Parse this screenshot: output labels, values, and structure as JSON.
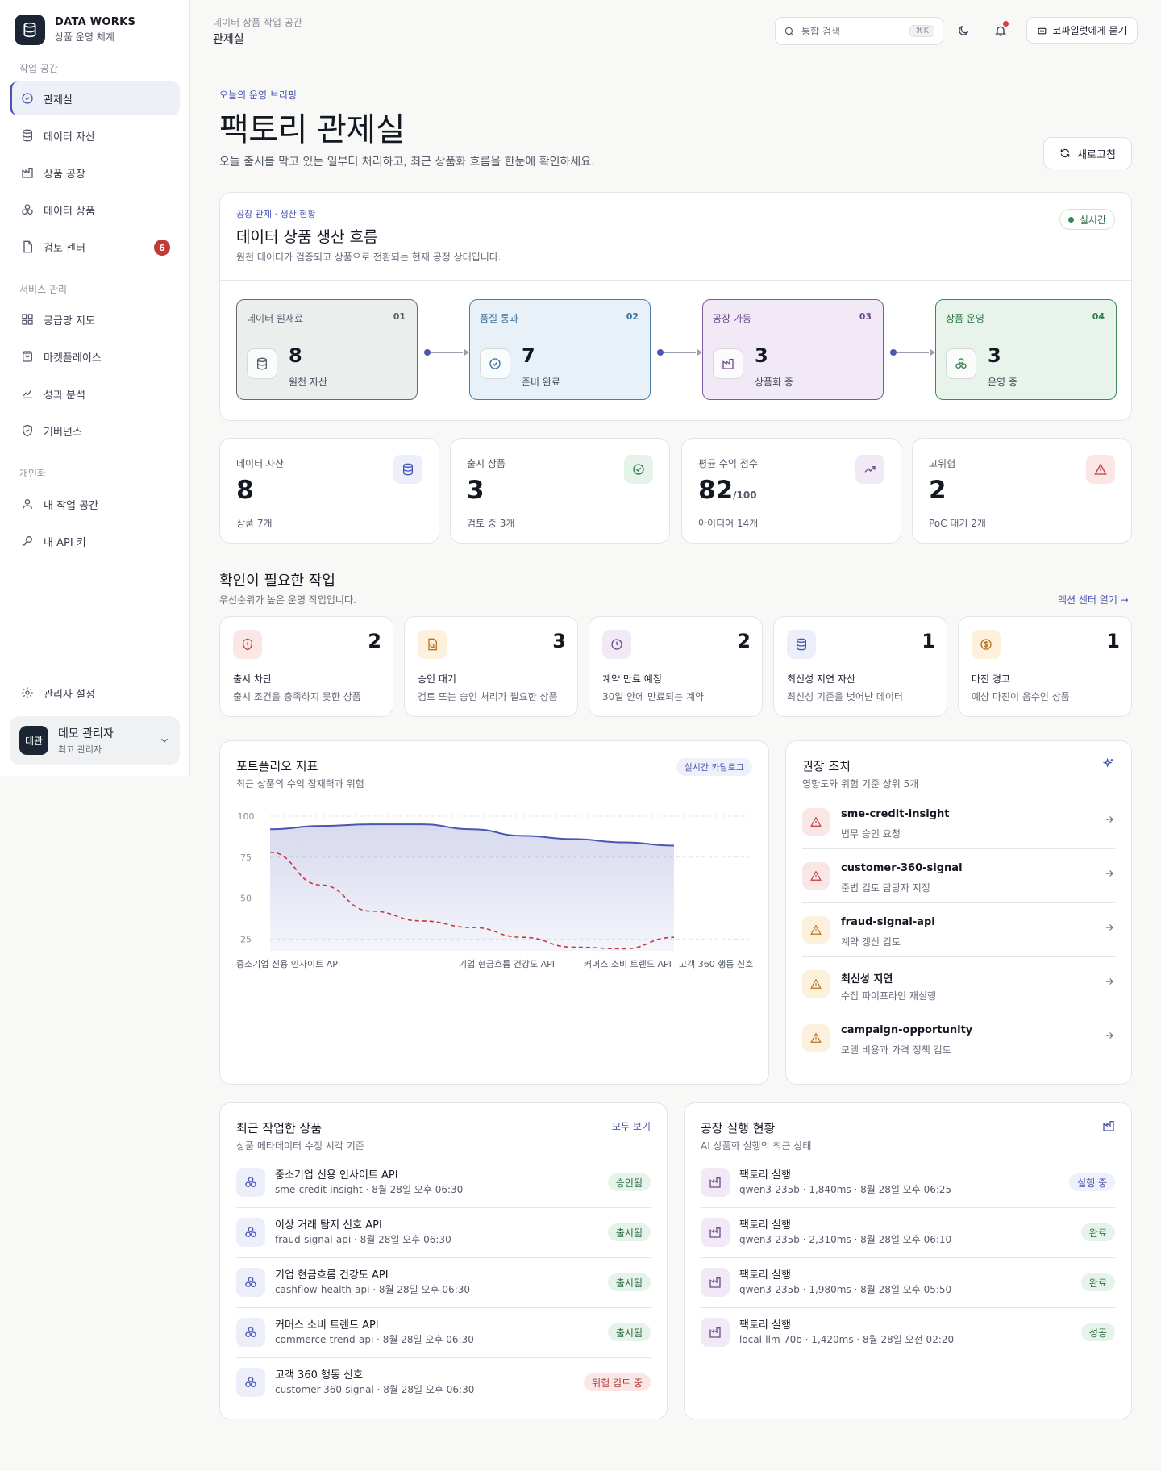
{
  "brand": {
    "title": "DATA WORKS",
    "subtitle": "상품 운영 체계"
  },
  "sidebar": {
    "sections": [
      {
        "label": "작업 공간"
      },
      {
        "label": "서비스 관리"
      },
      {
        "label": "개인화"
      }
    ],
    "items": [
      {
        "label": "관제실",
        "icon": "dashboard-icon"
      },
      {
        "label": "데이터 자산",
        "icon": "database-icon"
      },
      {
        "label": "상품 공장",
        "icon": "factory-icon"
      },
      {
        "label": "데이터 상품",
        "icon": "cubes-icon"
      },
      {
        "label": "검토 센터",
        "icon": "file-icon",
        "badge": "6"
      },
      {
        "label": "공급망 지도",
        "icon": "grid-icon"
      },
      {
        "label": "마켓플레이스",
        "icon": "shop-icon"
      },
      {
        "label": "성과 분석",
        "icon": "chart-icon"
      },
      {
        "label": "거버넌스",
        "icon": "shield-icon"
      },
      {
        "label": "내 작업 공간",
        "icon": "user-icon"
      },
      {
        "label": "내 API 키",
        "icon": "key-icon"
      }
    ],
    "settings": "관리자 설정",
    "user": {
      "avatar": "데관",
      "name": "데모 관리자",
      "role": "최고 관리자"
    }
  },
  "topbar": {
    "crumb_small": "데이터 상품 작업 공간",
    "crumb_main": "관제실",
    "search_placeholder": "통합 검색",
    "search_shortcut": "⌘K",
    "copilot": "코파일럿에게 묻기"
  },
  "hero": {
    "eyebrow": "오늘의 운영 브리핑",
    "title": "팩토리 관제실",
    "lead": "오늘 출시를 막고 있는 일부터 처리하고, 최근 상품화 흐름을 한눈에 확인하세요.",
    "refresh": "새로고침"
  },
  "flow": {
    "eyebrow": "공장 관제 · 생산 현황",
    "title": "데이터 상품 생산 흐름",
    "subtitle": "원천 데이터가 검증되고 상품으로 전환되는 현재 공정 상태입니다.",
    "live": "실시간",
    "stages": [
      {
        "label": "데이터 원재료",
        "num": "01",
        "value": "8",
        "caption": "원천 자산",
        "bg": "#eceeee",
        "border": "#636a6e",
        "color": "#555b6a"
      },
      {
        "label": "품질 통과",
        "num": "02",
        "value": "7",
        "caption": "준비 완료",
        "bg": "#e8f1f8",
        "border": "#4c7ca8",
        "color": "#3f6f97"
      },
      {
        "label": "공장 가동",
        "num": "03",
        "value": "3",
        "caption": "상품화 중",
        "bg": "#f1eaf6",
        "border": "#7d5a9c",
        "color": "#6e4c8c"
      },
      {
        "label": "상품 운영",
        "num": "04",
        "value": "3",
        "caption": "운영 중",
        "bg": "#e8f3ec",
        "border": "#3b8a58",
        "color": "#2f7a4a"
      }
    ]
  },
  "kpis": [
    {
      "label": "데이터 자산",
      "value": "8",
      "suffix": "",
      "sub": "상품 7개",
      "icon": "database-icon",
      "bg": "#eceefa",
      "fg": "#4a55b4"
    },
    {
      "label": "출시 상품",
      "value": "3",
      "suffix": "",
      "sub": "검토 중 3개",
      "icon": "check-circle-icon",
      "bg": "#e6f3ea",
      "fg": "#2f7a4a"
    },
    {
      "label": "평균 수익 점수",
      "value": "82",
      "suffix": "/100",
      "sub": "아이디어 14개",
      "icon": "trend-icon",
      "bg": "#f1eaf6",
      "fg": "#6e4c8c"
    },
    {
      "label": "고위험",
      "value": "2",
      "suffix": "",
      "sub": "PoC 대기 2개",
      "icon": "alert-icon",
      "bg": "#fbe6e6",
      "fg": "#c13b3b"
    }
  ],
  "actions_section": {
    "title": "확인이 필요한 작업",
    "subtitle": "우선순위가 높은 운영 작업입니다.",
    "link": "액션 센터 열기 →"
  },
  "actions": [
    {
      "count": "2",
      "title": "출시 차단",
      "desc": "출시 조건을 충족하지 못한 상품",
      "icon": "shield-alert-icon",
      "bg": "#fbe6e6",
      "fg": "#c13b3b"
    },
    {
      "count": "3",
      "title": "승인 대기",
      "desc": "검토 또는 승인 처리가 필요한 상품",
      "icon": "file-search-icon",
      "bg": "#fdf0dc",
      "fg": "#b5741c"
    },
    {
      "count": "2",
      "title": "계약 만료 예정",
      "desc": "30일 안에 만료되는 계약",
      "icon": "clock-icon",
      "bg": "#f1eaf6",
      "fg": "#6e4c8c"
    },
    {
      "count": "1",
      "title": "최신성 지연 자산",
      "desc": "최신성 기준을 벗어난 데이터",
      "icon": "database-icon",
      "bg": "#eceefa",
      "fg": "#4a55b4"
    },
    {
      "count": "1",
      "title": "마진 경고",
      "desc": "예상 마진이 음수인 상품",
      "icon": "dollar-icon",
      "bg": "#fdf0dc",
      "fg": "#b5741c"
    }
  ],
  "portfolio": {
    "title": "포트폴리오 지표",
    "subtitle": "최근 상품의 수익 잠재력과 위험",
    "chip": "실시간 카탈로그"
  },
  "chart_data": {
    "type": "area",
    "title": "",
    "x_labels": [
      "중소기업 신용 인사이트 API",
      "기업 현금흐름 건강도 API",
      "커머스 소비 트렌드 API",
      "고객 360 행동 신호"
    ],
    "yticks": [
      "0",
      "25",
      "50",
      "75",
      "100"
    ],
    "ylim": [
      0,
      100
    ],
    "grid": true,
    "series": [
      {
        "values": [
          92,
          94,
          95,
          95,
          92,
          88,
          86,
          84,
          82
        ],
        "style": "solid",
        "color": "#4a55b4"
      },
      {
        "values": [
          78,
          58,
          42,
          36,
          32,
          26,
          20,
          19,
          26
        ],
        "style": "dashed",
        "color": "#c13b3b"
      }
    ]
  },
  "recommendations": {
    "title": "권장 조치",
    "subtitle": "영향도와 위험 기준 상위 5개",
    "items": [
      {
        "title": "sme-credit-insight",
        "desc": "법무 승인 요청",
        "level": "high"
      },
      {
        "title": "customer-360-signal",
        "desc": "준법 검토 담당자 지정",
        "level": "high"
      },
      {
        "title": "fraud-signal-api",
        "desc": "계약 갱신 검토",
        "level": "medium"
      },
      {
        "title": "최신성 지연",
        "desc": "수집 파이프라인 재실행",
        "level": "medium"
      },
      {
        "title": "campaign-opportunity",
        "desc": "모델 비용과 가격 정책 검토",
        "level": "medium"
      }
    ]
  },
  "recent": {
    "title": "최근 작업한 상품",
    "subtitle": "상품 메타데이터 수정 시각 기준",
    "link": "모두 보기",
    "items": [
      {
        "title": "중소기업 신용 인사이트 API",
        "sub": "sme-credit-insight · 8월 28일 오후 06:30",
        "status": "승인됨",
        "tone": "green"
      },
      {
        "title": "이상 거래 탐지 신호 API",
        "sub": "fraud-signal-api · 8월 28일 오후 06:30",
        "status": "출시됨",
        "tone": "green"
      },
      {
        "title": "기업 현금흐름 건강도 API",
        "sub": "cashflow-health-api · 8월 28일 오후 06:30",
        "status": "출시됨",
        "tone": "green"
      },
      {
        "title": "커머스 소비 트렌드 API",
        "sub": "commerce-trend-api · 8월 28일 오후 06:30",
        "status": "출시됨",
        "tone": "green"
      },
      {
        "title": "고객 360 행동 신호",
        "sub": "customer-360-signal · 8월 28일 오후 06:30",
        "status": "위험 검토 중",
        "tone": "red"
      }
    ]
  },
  "runs": {
    "title": "공장 실행 현황",
    "subtitle": "AI 상품화 실행의 최근 상태",
    "items": [
      {
        "title": "팩토리 실행",
        "sub": "qwen3-235b · 1,840ms · 8월 28일 오후 06:25",
        "status": "실행 중",
        "tone": "blue"
      },
      {
        "title": "팩토리 실행",
        "sub": "qwen3-235b · 2,310ms · 8월 28일 오후 06:10",
        "status": "완료",
        "tone": "green"
      },
      {
        "title": "팩토리 실행",
        "sub": "qwen3-235b · 1,980ms · 8월 28일 오후 05:50",
        "status": "완료",
        "tone": "green"
      },
      {
        "title": "팩토리 실행",
        "sub": "local-llm-70b · 1,420ms · 8월 28일 오전 02:20",
        "status": "성공",
        "tone": "green"
      }
    ]
  }
}
